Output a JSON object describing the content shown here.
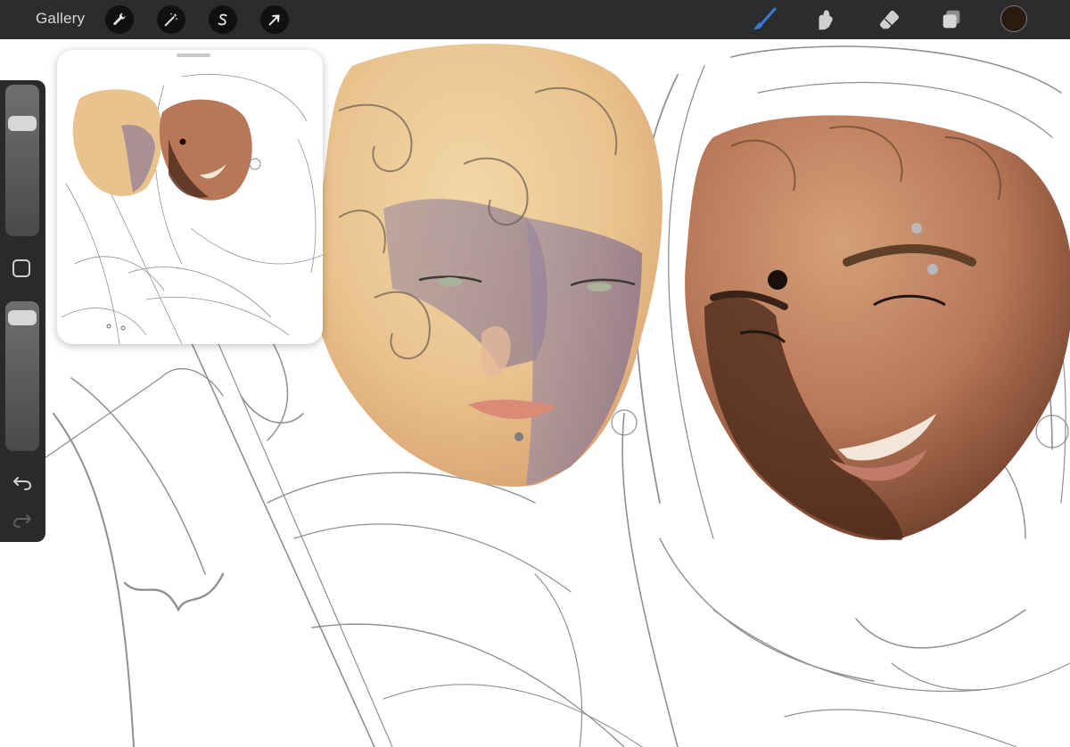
{
  "toolbar": {
    "gallery_label": "Gallery",
    "actions_icon": "wrench-icon",
    "adjustments_icon": "magic-wand-icon",
    "selection_icon": "selection-s-icon",
    "transform_icon": "arrow-cursor-icon",
    "brush_icon": "brush-icon",
    "smudge_icon": "smudge-finger-icon",
    "eraser_icon": "eraser-icon",
    "layers_icon": "layers-icon",
    "active_color": "#2a1a12"
  },
  "sidebar": {
    "brush_size_icon": "slider-icon",
    "brush_size_level": 0.22,
    "opacity_level": 0.05,
    "modify_icon": "square-icon",
    "undo_icon": "undo-arrow-icon",
    "redo_icon": "redo-arrow-icon"
  },
  "colors": {
    "toolbar_bg": "#2c2c2e",
    "brush_active": "#3a7bd5",
    "canvas_bg": "#ffffff"
  }
}
